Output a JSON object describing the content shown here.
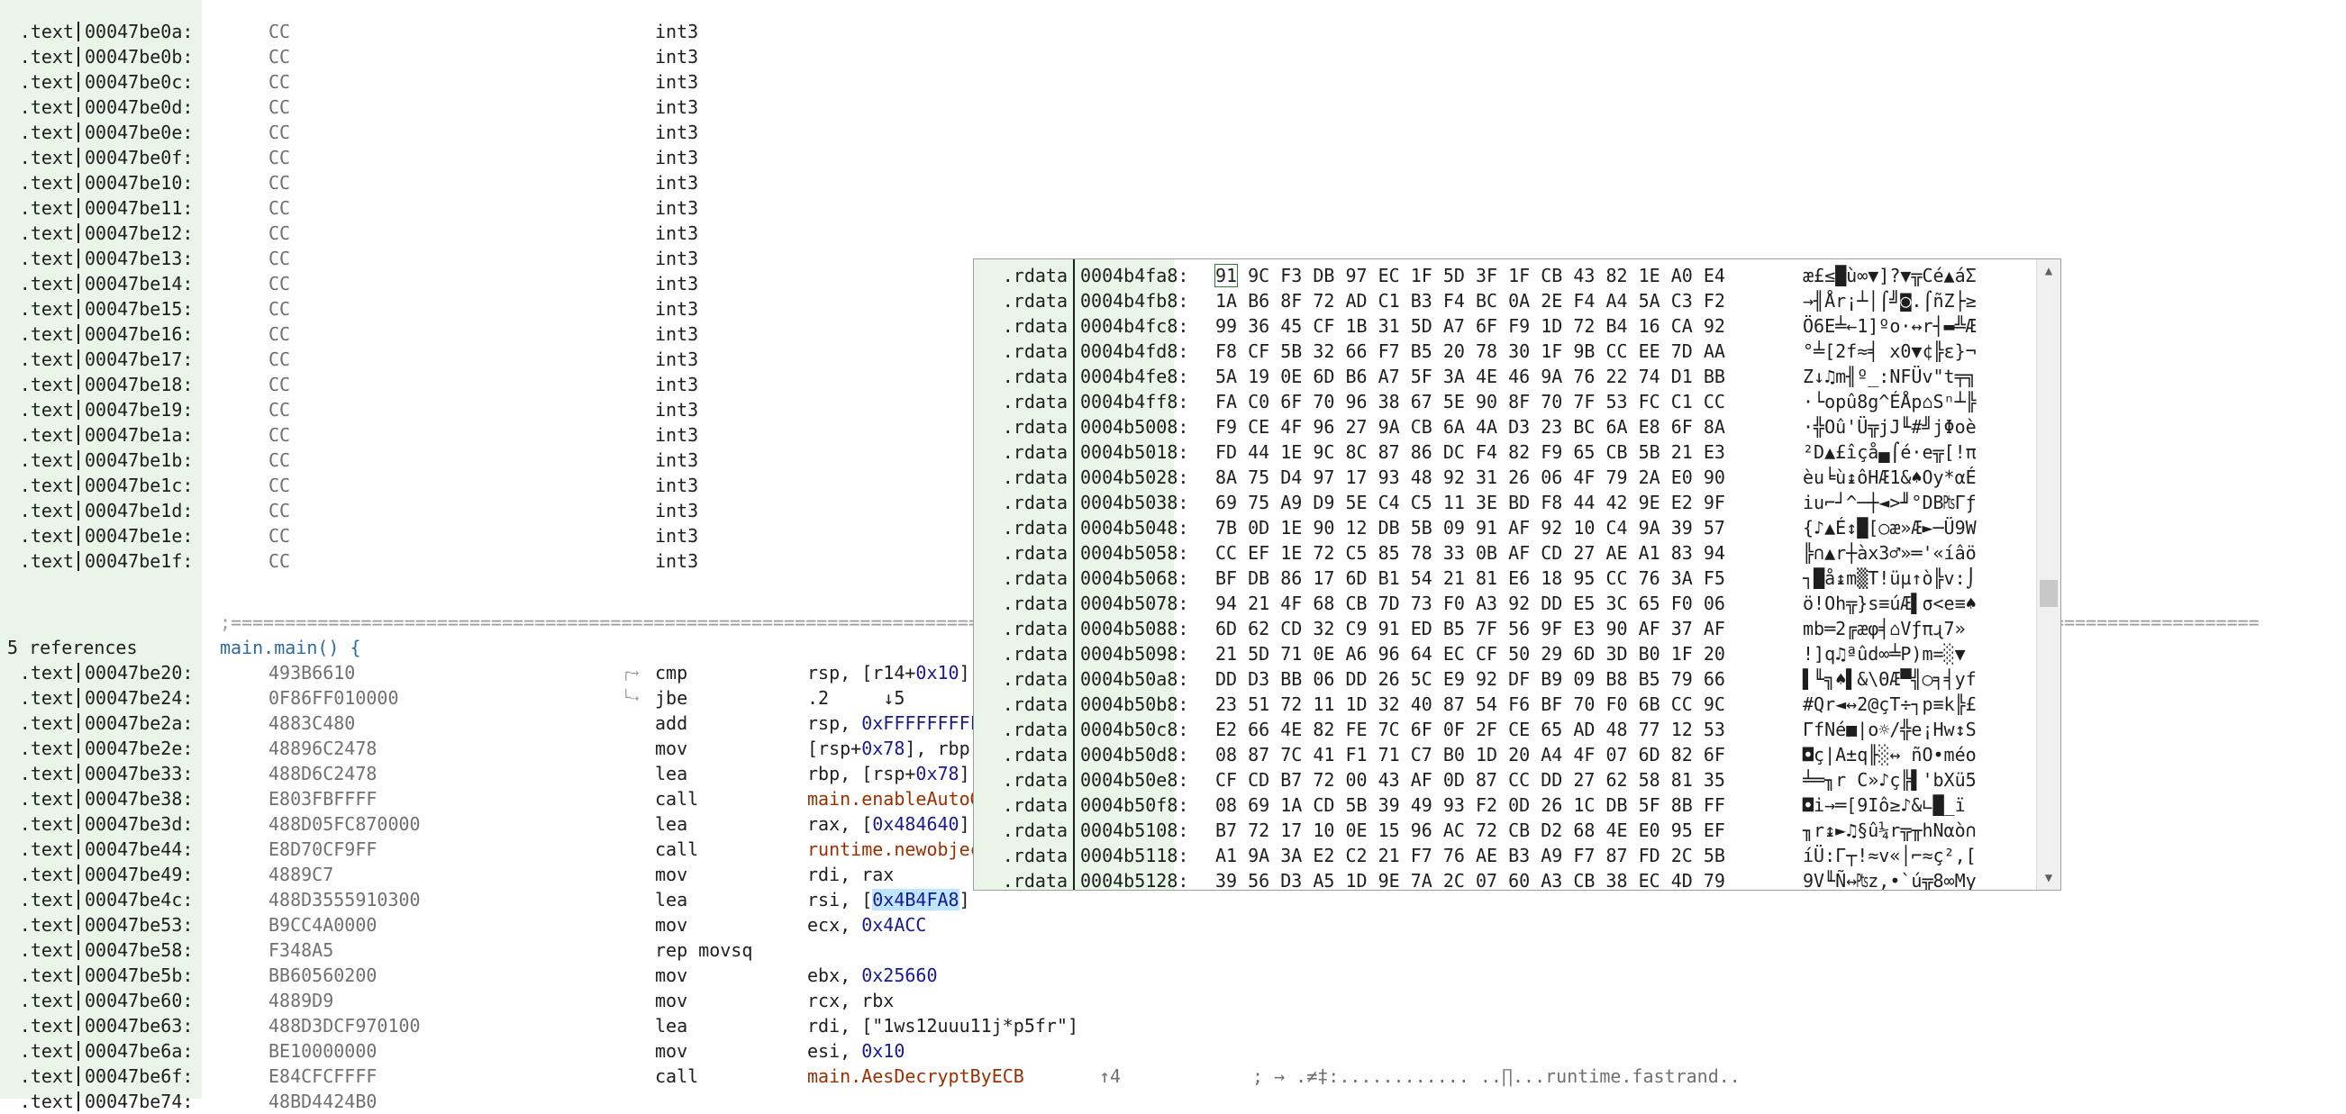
{
  "listing": {
    "int3_rows": [
      {
        "seg": ".text",
        "addr": "00047be0a:",
        "bytes": "CC",
        "mnem": "int3"
      },
      {
        "seg": ".text",
        "addr": "00047be0b:",
        "bytes": "CC",
        "mnem": "int3"
      },
      {
        "seg": ".text",
        "addr": "00047be0c:",
        "bytes": "CC",
        "mnem": "int3"
      },
      {
        "seg": ".text",
        "addr": "00047be0d:",
        "bytes": "CC",
        "mnem": "int3"
      },
      {
        "seg": ".text",
        "addr": "00047be0e:",
        "bytes": "CC",
        "mnem": "int3"
      },
      {
        "seg": ".text",
        "addr": "00047be0f:",
        "bytes": "CC",
        "mnem": "int3"
      },
      {
        "seg": ".text",
        "addr": "00047be10:",
        "bytes": "CC",
        "mnem": "int3"
      },
      {
        "seg": ".text",
        "addr": "00047be11:",
        "bytes": "CC",
        "mnem": "int3"
      },
      {
        "seg": ".text",
        "addr": "00047be12:",
        "bytes": "CC",
        "mnem": "int3"
      },
      {
        "seg": ".text",
        "addr": "00047be13:",
        "bytes": "CC",
        "mnem": "int3"
      },
      {
        "seg": ".text",
        "addr": "00047be14:",
        "bytes": "CC",
        "mnem": "int3"
      },
      {
        "seg": ".text",
        "addr": "00047be15:",
        "bytes": "CC",
        "mnem": "int3"
      },
      {
        "seg": ".text",
        "addr": "00047be16:",
        "bytes": "CC",
        "mnem": "int3"
      },
      {
        "seg": ".text",
        "addr": "00047be17:",
        "bytes": "CC",
        "mnem": "int3"
      },
      {
        "seg": ".text",
        "addr": "00047be18:",
        "bytes": "CC",
        "mnem": "int3"
      },
      {
        "seg": ".text",
        "addr": "00047be19:",
        "bytes": "CC",
        "mnem": "int3"
      },
      {
        "seg": ".text",
        "addr": "00047be1a:",
        "bytes": "CC",
        "mnem": "int3"
      },
      {
        "seg": ".text",
        "addr": "00047be1b:",
        "bytes": "CC",
        "mnem": "int3"
      },
      {
        "seg": ".text",
        "addr": "00047be1c:",
        "bytes": "CC",
        "mnem": "int3"
      },
      {
        "seg": ".text",
        "addr": "00047be1d:",
        "bytes": "CC",
        "mnem": "int3"
      },
      {
        "seg": ".text",
        "addr": "00047be1e:",
        "bytes": "CC",
        "mnem": "int3"
      },
      {
        "seg": ".text",
        "addr": "00047be1f:",
        "bytes": "CC",
        "mnem": "int3"
      }
    ],
    "divider": ";===========================================================================================================================================================================================",
    "refs_label": "5 references",
    "func_header": "main.main() {",
    "code_rows": [
      {
        "seg": ".text",
        "addr": "00047be20:",
        "bytes": "493B6610",
        "mnem": "cmp",
        "ops": "rsp, [r14+0x10]",
        "tail": ""
      },
      {
        "seg": ".text",
        "addr": "00047be24:",
        "bytes": "0F86FF010000",
        "mnem": "jbe",
        "ops": ".2     ↓5",
        "tail": ""
      },
      {
        "seg": ".text",
        "addr": "00047be2a:",
        "bytes": "4883C480",
        "mnem": "add",
        "ops": "rsp, 0xFFFFFFFFFFFFFF80",
        "tail": ""
      },
      {
        "seg": ".text",
        "addr": "00047be2e:",
        "bytes": "48896C2478",
        "mnem": "mov",
        "ops": "[rsp+0x78], rbp",
        "tail": ""
      },
      {
        "seg": ".text",
        "addr": "00047be33:",
        "bytes": "488D6C2478",
        "mnem": "lea",
        "ops": "rbp, [rsp+0x78]",
        "tail": ""
      },
      {
        "seg": ".text",
        "addr": "00047be38:",
        "bytes": "E803FBFFFF",
        "mnem": "call",
        "ops": "main.enableAutoGC",
        "tail": ""
      },
      {
        "seg": ".text",
        "addr": "00047be3d:",
        "bytes": "488D05FC870000",
        "mnem": "lea",
        "ops": "rax, [0x484640]",
        "tail": ""
      },
      {
        "seg": ".text",
        "addr": "00047be44:",
        "bytes": "E8D70CF9FF",
        "mnem": "call",
        "ops": "runtime.newobject",
        "tail": ""
      },
      {
        "seg": ".text",
        "addr": "00047be49:",
        "bytes": "4889C7",
        "mnem": "mov",
        "ops": "rdi, rax",
        "tail": ""
      },
      {
        "seg": ".text",
        "addr": "00047be4c:",
        "bytes": "488D3555910300",
        "mnem": "lea",
        "ops": "rsi, [0x4B4FA8]",
        "tail": ""
      },
      {
        "seg": ".text",
        "addr": "00047be53:",
        "bytes": "B9CC4A0000",
        "mnem": "mov",
        "ops": "ecx, 0x4ACC",
        "tail": ""
      },
      {
        "seg": ".text",
        "addr": "00047be58:",
        "bytes": "F348A5",
        "mnem": "rep movsq",
        "ops": "",
        "tail": ""
      },
      {
        "seg": ".text",
        "addr": "00047be5b:",
        "bytes": "BB60560200",
        "mnem": "mov",
        "ops": "ebx, 0x25660",
        "tail": ""
      },
      {
        "seg": ".text",
        "addr": "00047be60:",
        "bytes": "4889D9",
        "mnem": "mov",
        "ops": "rcx, rbx",
        "tail": ""
      },
      {
        "seg": ".text",
        "addr": "00047be63:",
        "bytes": "488D3DCF970100",
        "mnem": "lea",
        "ops": "rdi, [\"1ws12uuu11j*p5fr\"]",
        "tail": ""
      },
      {
        "seg": ".text",
        "addr": "00047be6a:",
        "bytes": "BE10000000",
        "mnem": "mov",
        "ops": "esi, 0x10",
        "tail": ""
      },
      {
        "seg": ".text",
        "addr": "00047be6f:",
        "bytes": "E84CFCFFFF",
        "mnem": "call",
        "ops": "main.AesDecryptByECB",
        "tail": "↑4"
      }
    ],
    "last_comment": "; → .≠‡:............ ..∏...runtime.fastrand..",
    "partial_row": {
      "seg": ".text",
      "addr": "00047be74:",
      "bytes": "48BD4424B0"
    }
  },
  "hex_popup": {
    "rows": [
      {
        "seg": ".rdata",
        "addr": "0004b4fa8:",
        "hex": "91 9C F3 DB 97 EC 1F 5D 3F 1F CB 43 82 1E A0 E4",
        "ascii": "æ£≤█ù∞▼]?▼╦Cé▲áΣ"
      },
      {
        "seg": ".rdata",
        "addr": "0004b4fb8:",
        "hex": "1A B6 8F 72 AD C1 B3 F4 BC 0A 2E F4 A4 5A C3 F2",
        "ascii": "→╢År¡┴│⌠╝◙.⌠ñZ├≥"
      },
      {
        "seg": ".rdata",
        "addr": "0004b4fc8:",
        "hex": "99 36 45 CF 1B 31 5D A7 6F F9 1D 72 B4 16 CA 92",
        "ascii": "Ö6E╧←1]ºo·↔r┤▬╩Æ"
      },
      {
        "seg": ".rdata",
        "addr": "0004b4fd8:",
        "hex": "F8 CF 5B 32 66 F7 B5 20 78 30 1F 9B CC EE 7D AA",
        "ascii": "°╧[2f≈╡ x0▼¢╠ε}¬"
      },
      {
        "seg": ".rdata",
        "addr": "0004b4fe8:",
        "hex": "5A 19 0E 6D B6 A7 5F 3A 4E 46 9A 76 22 74 D1 BB",
        "ascii": "Z↓♫m╢º_:NFÜv\"t╤╗"
      },
      {
        "seg": ".rdata",
        "addr": "0004b4ff8:",
        "hex": "FA C0 6F 70 96 38 67 5E 90 8F 70 7F 53 FC C1 CC",
        "ascii": "·└opû8g^ÉÅp⌂Sⁿ┴╠"
      },
      {
        "seg": ".rdata",
        "addr": "0004b5008:",
        "hex": "F9 CE 4F 96 27 9A CB 6A 4A D3 23 BC 6A E8 6F 8A",
        "ascii": "·╬Oû'Ü╦jJ╙#╝jΦoè"
      },
      {
        "seg": ".rdata",
        "addr": "0004b5018:",
        "hex": "FD 44 1E 9C 8C 87 86 DC F4 82 F9 65 CB 5B 21 E3",
        "ascii": "²D▲£îçå▄⌠é·e╦[!π"
      },
      {
        "seg": ".rdata",
        "addr": "0004b5028:",
        "hex": "8A 75 D4 97 17 93 48 92 31 26 06 4F 79 2A E0 90",
        "ascii": "èu╘ù↨ôHÆ1&♠Oy*αÉ"
      },
      {
        "seg": ".rdata",
        "addr": "0004b5038:",
        "hex": "69 75 A9 D9 5E C4 C5 11 3E BD F8 44 42 9E E2 9F",
        "ascii": "iu⌐┘^─┼◄>╜°DB₧Γƒ"
      },
      {
        "seg": ".rdata",
        "addr": "0004b5048:",
        "hex": "7B 0D 1E 90 12 DB 5B 09 91 AF 92 10 C4 9A 39 57",
        "ascii": "{♪▲É↕█[○æ»Æ►─Ü9W"
      },
      {
        "seg": ".rdata",
        "addr": "0004b5058:",
        "hex": "CC EF 1E 72 C5 85 78 33 0B AF CD 27 AE A1 83 94",
        "ascii": "╠∩▲r┼àx3♂»═'«íâö"
      },
      {
        "seg": ".rdata",
        "addr": "0004b5068:",
        "hex": "BF DB 86 17 6D B1 54 21 81 E6 18 95 CC 76 3A F5",
        "ascii": "┐█å↨m▒T!üµ↑ò╠v:⌡"
      },
      {
        "seg": ".rdata",
        "addr": "0004b5078:",
        "hex": "94 21 4F 68 CB 7D 73 F0 A3 92 DD E5 3C 65 F0 06",
        "ascii": "ö!Oh╦}s≡úÆ▌σ<e≡♠"
      },
      {
        "seg": ".rdata",
        "addr": "0004b5088:",
        "hex": "6D 62 CD 32 C9 91 ED B5 7F 56 9F E3 90 AF 37 AF",
        "ascii": "mb═2╔æφ╡⌂Vƒπɻ7»"
      },
      {
        "seg": ".rdata",
        "addr": "0004b5098:",
        "hex": "21 5D 71 0E A6 96 64 EC CF 50 29 6D 3D B0 1F 20",
        "ascii": "!]q♫ªûd∞╧P)m=░▼ "
      },
      {
        "seg": ".rdata",
        "addr": "0004b50a8:",
        "hex": "DD D3 BB 06 DD 26 5C E9 92 DF B9 09 B8 B5 79 66",
        "ascii": "▌╙╗♠▌&\\ΘÆ▀╣○╕╡yf"
      },
      {
        "seg": ".rdata",
        "addr": "0004b50b8:",
        "hex": "23 51 72 11 1D 32 40 87 54 F6 BF 70 F0 6B CC 9C",
        "ascii": "#Qr◄↔2@çT÷┐p≡k╠£"
      },
      {
        "seg": ".rdata",
        "addr": "0004b50c8:",
        "hex": "E2 66 4E 82 FE 7C 6F 0F 2F CE 65 AD 48 77 12 53",
        "ascii": "ΓfNé■|o☼/╬e¡Hw↕S"
      },
      {
        "seg": ".rdata",
        "addr": "0004b50d8:",
        "hex": "08 87 7C 41 F1 71 C7 B0 1D 20 A4 4F 07 6D 82 6F",
        "ascii": "◘ç|A±q╟░↔ ñO•méo"
      },
      {
        "seg": ".rdata",
        "addr": "0004b50e8:",
        "hex": "CF CD B7 72 00 43 AF 0D 87 CC DD 27 62 58 81 35",
        "ascii": "╧═╖r C»♪ç╠▌'bXü5"
      },
      {
        "seg": ".rdata",
        "addr": "0004b50f8:",
        "hex": "08 69 1A CD 5B 39 49 93 F2 0D 26 1C DB 5F 8B FF",
        "ascii": "◘i→═[9Iô≥♪&∟█_ï "
      },
      {
        "seg": ".rdata",
        "addr": "0004b5108:",
        "hex": "B7 72 17 10 0E 15 96 AC 72 CB D2 68 4E E0 95 EF",
        "ascii": "╖r↨►♫§û¼r╦╥hNαò∩"
      },
      {
        "seg": ".rdata",
        "addr": "0004b5118:",
        "hex": "A1 9A 3A E2 C2 21 F7 76 AE B3 A9 F7 87 FD 2C 5B",
        "ascii": "íÜ:Γ┬!≈v«│⌐≈ç²,["
      },
      {
        "seg": ".rdata",
        "addr": "0004b5128:",
        "hex": "39 56 D3 A5 1D 9E 7A 2C 07 60 A3 CB 38 EC 4D 79",
        "ascii": "9V╙Ñ↔₧z,•`ú╦8∞My"
      }
    ],
    "cursor_byte": "91"
  },
  "colors": {
    "gutter": "#e8f5e8",
    "symbol": "#9b2f00",
    "number": "#1a1a8f",
    "function": "#2e6b9e",
    "highlight": "#bfe6ff"
  },
  "icons": {
    "scroll_up": "chevron-up-icon",
    "scroll_down": "chevron-down-icon",
    "jump_arrow": "branch-arrow-icon"
  }
}
